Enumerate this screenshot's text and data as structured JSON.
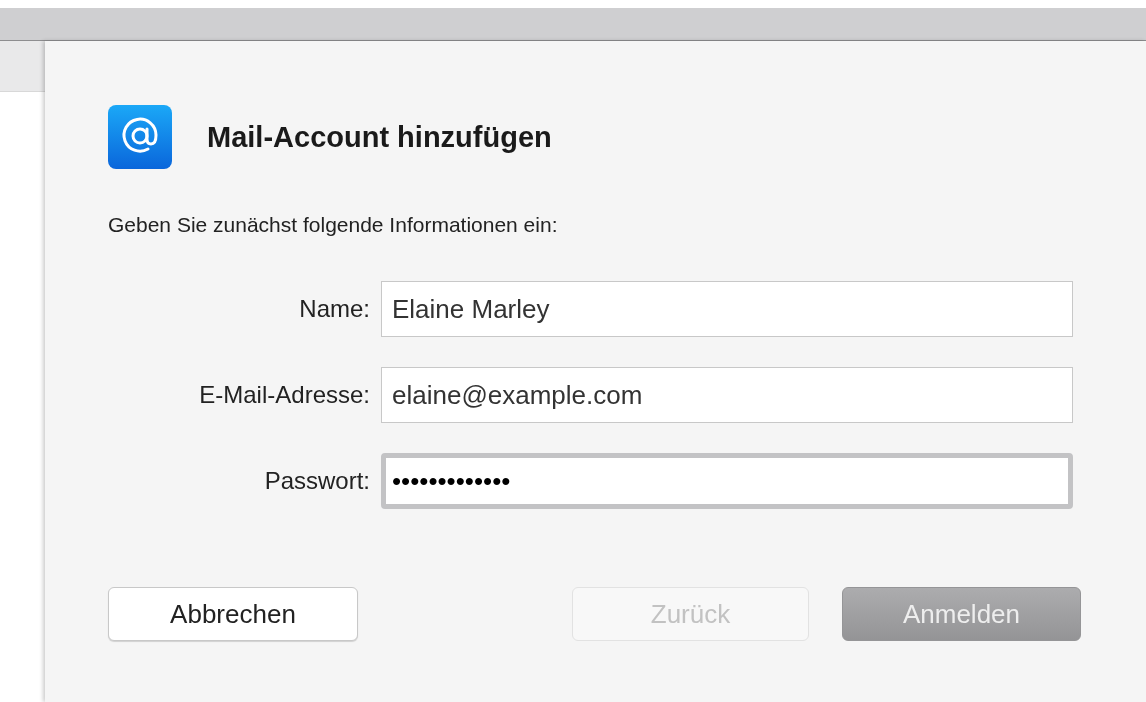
{
  "dialog": {
    "title": "Mail-Account hinzufügen",
    "instructions": "Geben Sie zunächst folgende Informationen ein:"
  },
  "fields": [
    {
      "label": "Name:",
      "value": "Elaine Marley",
      "focused": false
    },
    {
      "label": "E-Mail-Adresse:",
      "value": "elaine@example.com",
      "focused": false
    },
    {
      "label": "Passwort:",
      "value": "•••••••••••••",
      "focused": true
    }
  ],
  "buttons": [
    {
      "label": "Abbrechen",
      "kind": "normal",
      "disabled": false
    },
    {
      "label": "Zurück",
      "kind": "normal",
      "disabled": true
    },
    {
      "label": "Anmelden",
      "kind": "default",
      "disabled": true
    }
  ]
}
